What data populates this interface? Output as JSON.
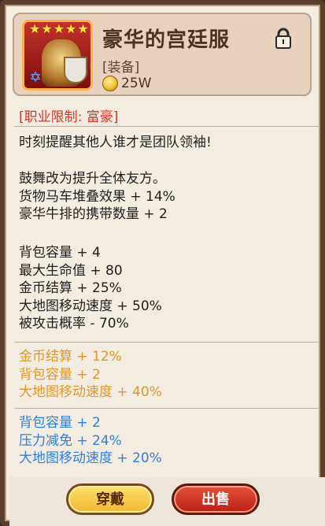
{
  "item": {
    "title": "豪华的宫廷服",
    "category": "[装备]",
    "price": "25W",
    "stars": [
      "★",
      "★",
      "★",
      "★",
      "★"
    ],
    "rank_badge": "✡"
  },
  "restriction": "[职业限制: 富豪]",
  "flavor": "时刻提醒其他人谁才是团队领袖!",
  "effects": [
    "鼓舞改为提升全体友方。",
    "货物马车堆叠效果 + 14%",
    "豪华牛排的携带数量 + 2"
  ],
  "stats": [
    "背包容量 + 4",
    "最大生命值 + 80",
    "金币结算 + 25%",
    "大地图移动速度 + 50%",
    "被攻击概率 - 70%"
  ],
  "orange_stats": [
    "金币结算 + 12%",
    "背包容量 + 2",
    "大地图移动速度 + 40%"
  ],
  "blue_stats": [
    "背包容量 + 2",
    "压力减免 + 24%",
    "大地图移动速度 + 20%"
  ],
  "buttons": {
    "equip": "穿戴",
    "sell": "出售"
  },
  "colors": {
    "restriction": "#d4372a",
    "orange": "#e2962b",
    "blue": "#2f7fe0"
  },
  "icons": {
    "lock": "lock-icon",
    "close": "close-icon",
    "coin": "coin-icon"
  }
}
